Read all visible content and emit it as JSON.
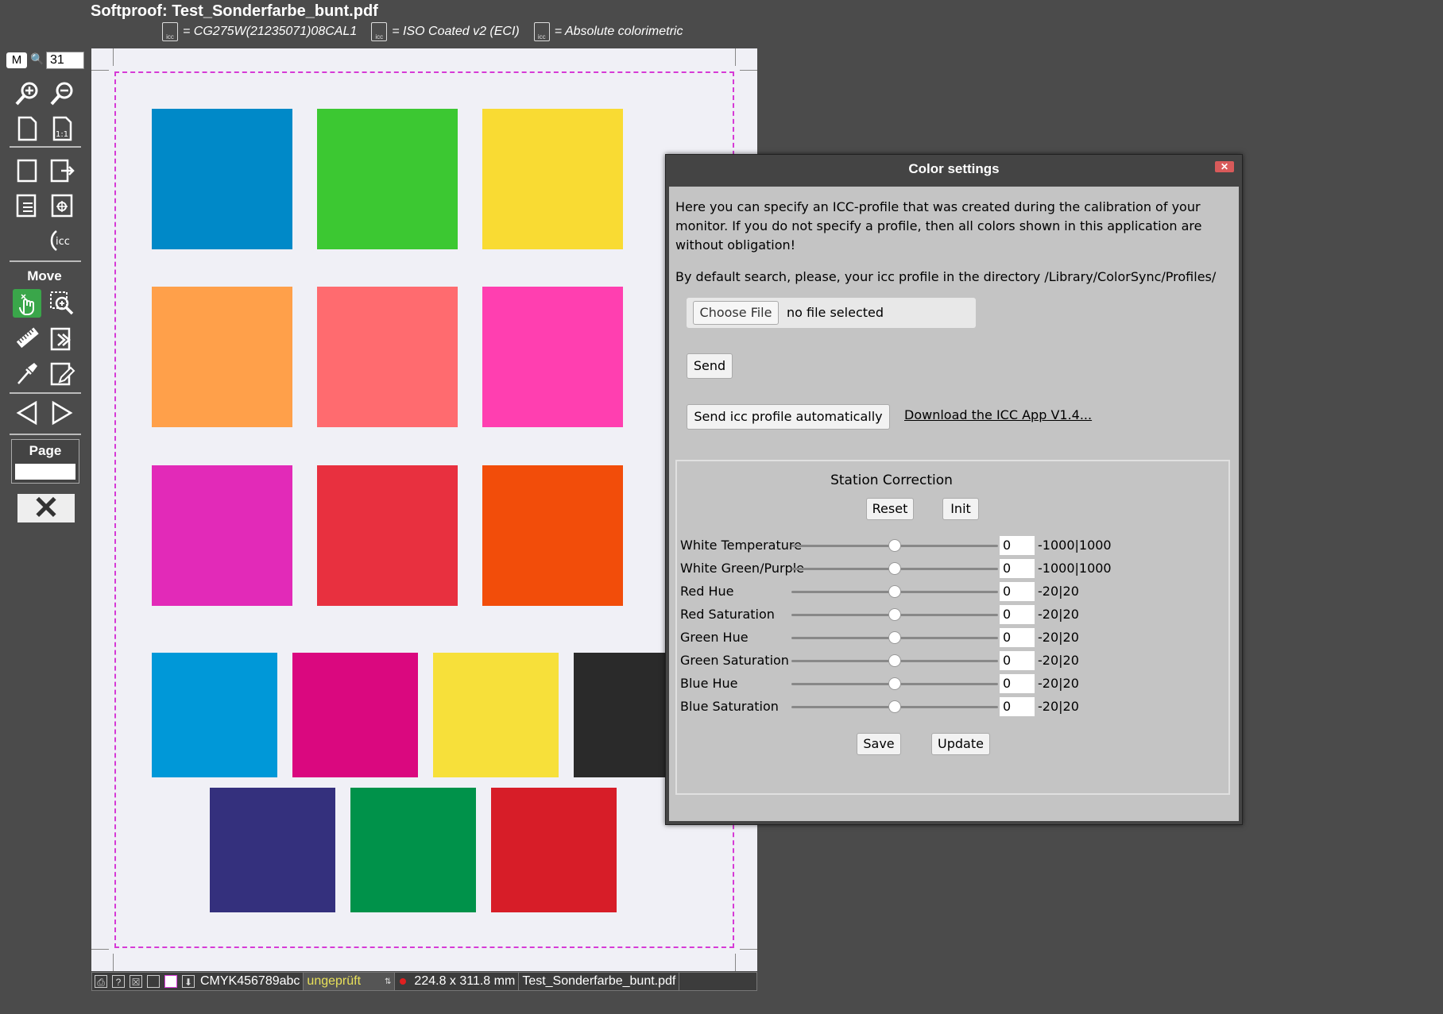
{
  "header": {
    "title": "Softproof: Test_Sonderfarbe_bunt.pdf",
    "monitor_profile": "= CG275W(21235071)08CAL1",
    "output_profile": "= ISO Coated v2 (ECI)",
    "intent": "= Absolute colorimetric",
    "icon_text": "icc"
  },
  "toolbar": {
    "mode": "M",
    "zoom_value": "31",
    "move_label": "Move",
    "page_label": "Page",
    "icc_text": "icc"
  },
  "document": {
    "background": "#f0f0f6",
    "trim_color": "#d63ad6",
    "row1": [
      "#0089c8",
      "#3cc832",
      "#f9db33"
    ],
    "row2": [
      "#ffa04a",
      "#ff6b6f",
      "#ff3fb0"
    ],
    "row3": [
      "#e22ab8",
      "#e8303f",
      "#f24d0a"
    ],
    "row4": [
      "#0098d8",
      "#da087f",
      "#f7e03a",
      "#2a2a2a"
    ],
    "row5": [
      "#34307d",
      "#00924a",
      "#d71d28"
    ]
  },
  "status": {
    "channels": "CMYK456789abc",
    "check_state": "ungeprüft",
    "size": "224.8 x 311.8 mm",
    "filename": "Test_Sonderfarbe_bunt.pdf"
  },
  "dialog": {
    "title": "Color settings",
    "close": "✕",
    "intro_1": "Here you can specify an ICC-profile that was created during the calibration of your",
    "intro_2": "monitor. If you do not specify a profile, then all colors shown in this application are",
    "intro_3": "without obligation!",
    "default_dir": "By default search, please, your icc profile in the directory /Library/ColorSync/Profiles/",
    "choose_file": "Choose File",
    "no_file": "no file selected",
    "send": "Send",
    "send_auto": "Send icc profile automatically",
    "download_link": "Download the ICC App V1.4...",
    "station": {
      "title": "Station Correction",
      "reset": "Reset",
      "init": "Init",
      "save": "Save",
      "update": "Update",
      "rows": [
        {
          "label": "White Temperature",
          "value": "0",
          "range": "-1000|1000",
          "level": 0.5
        },
        {
          "label": "White Green/Purple",
          "value": "0",
          "range": "-1000|1000",
          "level": 0.5
        },
        {
          "label": "Red Hue",
          "value": "0",
          "range": "-20|20",
          "level": 0.5
        },
        {
          "label": "Red Saturation",
          "value": "0",
          "range": "-20|20",
          "level": 0.5
        },
        {
          "label": "Green Hue",
          "value": "0",
          "range": "-20|20",
          "level": 0.5
        },
        {
          "label": "Green Saturation",
          "value": "0",
          "range": "-20|20",
          "level": 0.5
        },
        {
          "label": "Blue Hue",
          "value": "0",
          "range": "-20|20",
          "level": 0.5
        },
        {
          "label": "Blue Saturation",
          "value": "0",
          "range": "-20|20",
          "level": 0.5
        }
      ]
    }
  }
}
